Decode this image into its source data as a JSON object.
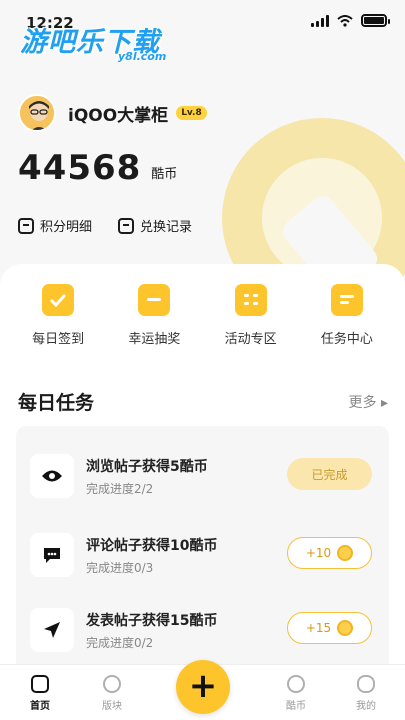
{
  "status_bar": {
    "time": "12:22"
  },
  "watermark": {
    "title": "游吧乐下载",
    "subtitle": "y8l.com"
  },
  "profile": {
    "username": "iQOO大掌柜",
    "level_badge": "Lv.8"
  },
  "coins": {
    "amount": "44568",
    "unit": "酷币"
  },
  "links": [
    {
      "label": "积分明细"
    },
    {
      "label": "兑换记录"
    }
  ],
  "quick_actions": [
    {
      "label": "每日签到",
      "icon": "calendar-check-icon"
    },
    {
      "label": "幸运抽奖",
      "icon": "gift-box-icon"
    },
    {
      "label": "活动专区",
      "icon": "grid-list-icon"
    },
    {
      "label": "任务中心",
      "icon": "task-list-icon"
    }
  ],
  "daily_tasks": {
    "title": "每日任务",
    "more": "更多 ▸",
    "items": [
      {
        "title": "浏览帖子获得5酷币",
        "progress": "完成进度2/2",
        "button": "已完成",
        "state": "done",
        "icon": "eye-icon"
      },
      {
        "title": "评论帖子获得10酷币",
        "progress": "完成进度0/3",
        "button": "+10",
        "state": "reward",
        "icon": "comment-icon"
      },
      {
        "title": "发表帖子获得15酷币",
        "progress": "完成进度0/2",
        "button": "+15",
        "state": "reward",
        "icon": "send-icon"
      }
    ]
  },
  "tab_bar": [
    {
      "label": "首页",
      "active": true
    },
    {
      "label": "版块",
      "active": false
    },
    {
      "label": "酷币",
      "active": false
    },
    {
      "label": "我的",
      "active": false
    }
  ],
  "colors": {
    "accent": "#fdc52b",
    "done_bg": "#fbe7ad",
    "text": "#1b1b1b"
  }
}
